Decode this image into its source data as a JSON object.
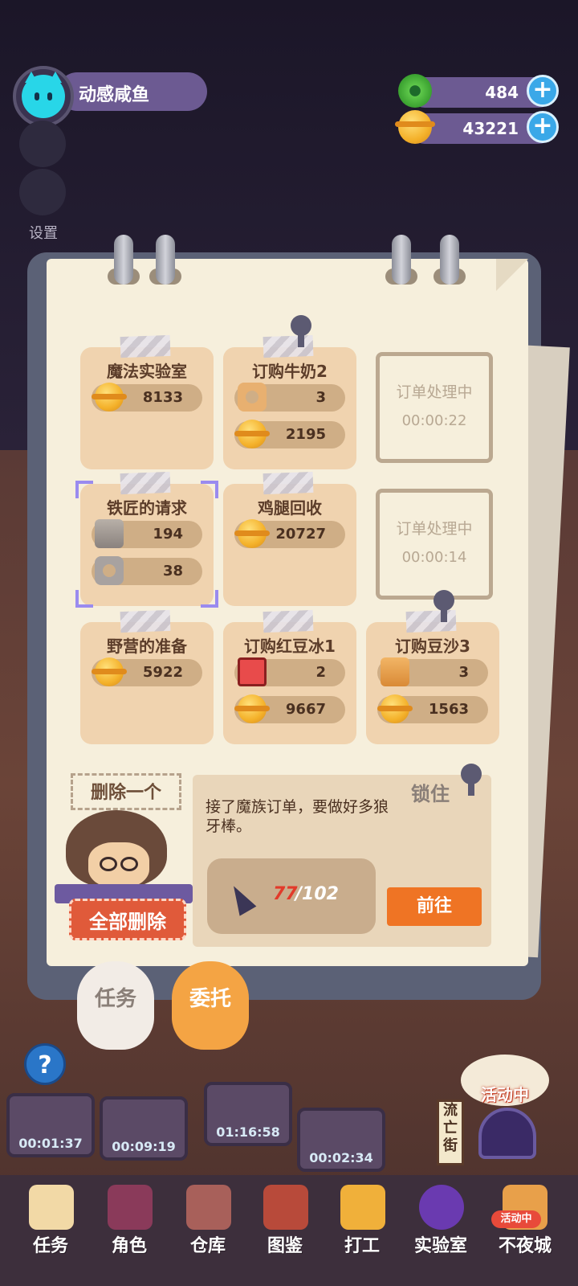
{
  "player": {
    "name": "动感咸鱼"
  },
  "settings_label": "设置",
  "currencies": [
    {
      "icon": "donut-icon",
      "value": "484"
    },
    {
      "icon": "coin-icon",
      "value": "43221"
    }
  ],
  "orders": [
    {
      "title": "魔法实验室",
      "rewards": [
        {
          "icon": "coin-icon",
          "value": "8133"
        }
      ]
    },
    {
      "title": "订购牛奶2",
      "rewards": [
        {
          "icon": "nut-icon",
          "value": "3"
        },
        {
          "icon": "coin-icon",
          "value": "2195"
        }
      ]
    },
    {
      "title": "铁匠的请求",
      "rewards": [
        {
          "icon": "bolt-icon",
          "value": "194"
        },
        {
          "icon": "nut-icon",
          "value": "38"
        }
      ]
    },
    {
      "title": "鸡腿回收",
      "rewards": [
        {
          "icon": "coin-icon",
          "value": "20727"
        }
      ]
    },
    {
      "title": "野营的准备",
      "rewards": [
        {
          "icon": "coin-icon",
          "value": "5922"
        }
      ]
    },
    {
      "title": "订购红豆冰1",
      "rewards": [
        {
          "icon": "red-box-icon",
          "value": "2"
        },
        {
          "icon": "coin-icon",
          "value": "9667"
        }
      ]
    },
    {
      "title": "订购豆沙3",
      "rewards": [
        {
          "icon": "bolt-icon",
          "value": "3"
        },
        {
          "icon": "coin-icon",
          "value": "1563"
        }
      ]
    }
  ],
  "processing": [
    {
      "label": "订单处理中",
      "countdown": "00:00:22"
    },
    {
      "label": "订单处理中",
      "countdown": "00:00:14"
    }
  ],
  "delete_one": "删除一个",
  "delete_all": "全部删除",
  "detail": {
    "lock_label": "锁住",
    "description": "接了魔族订单，要做好多狼牙棒。",
    "item_icon": "fang-icon",
    "progress_current": "77",
    "progress_total": "/102",
    "go_label": "前往"
  },
  "tabs": {
    "task": "任务",
    "commission": "委托"
  },
  "timers": [
    "00:01:37",
    "00:09:19",
    "01:16:58",
    "00:02:34"
  ],
  "activity_label": "活动中",
  "street_label": "流亡街",
  "nav": [
    "任务",
    "角色",
    "仓库",
    "图鉴",
    "打工",
    "实验室",
    "不夜城"
  ],
  "nav_badge": "活动中",
  "colors": {
    "accent": "#ef7424",
    "card": "#f0d3af",
    "paper": "#f6efdc",
    "pill": "#6c5a92"
  }
}
